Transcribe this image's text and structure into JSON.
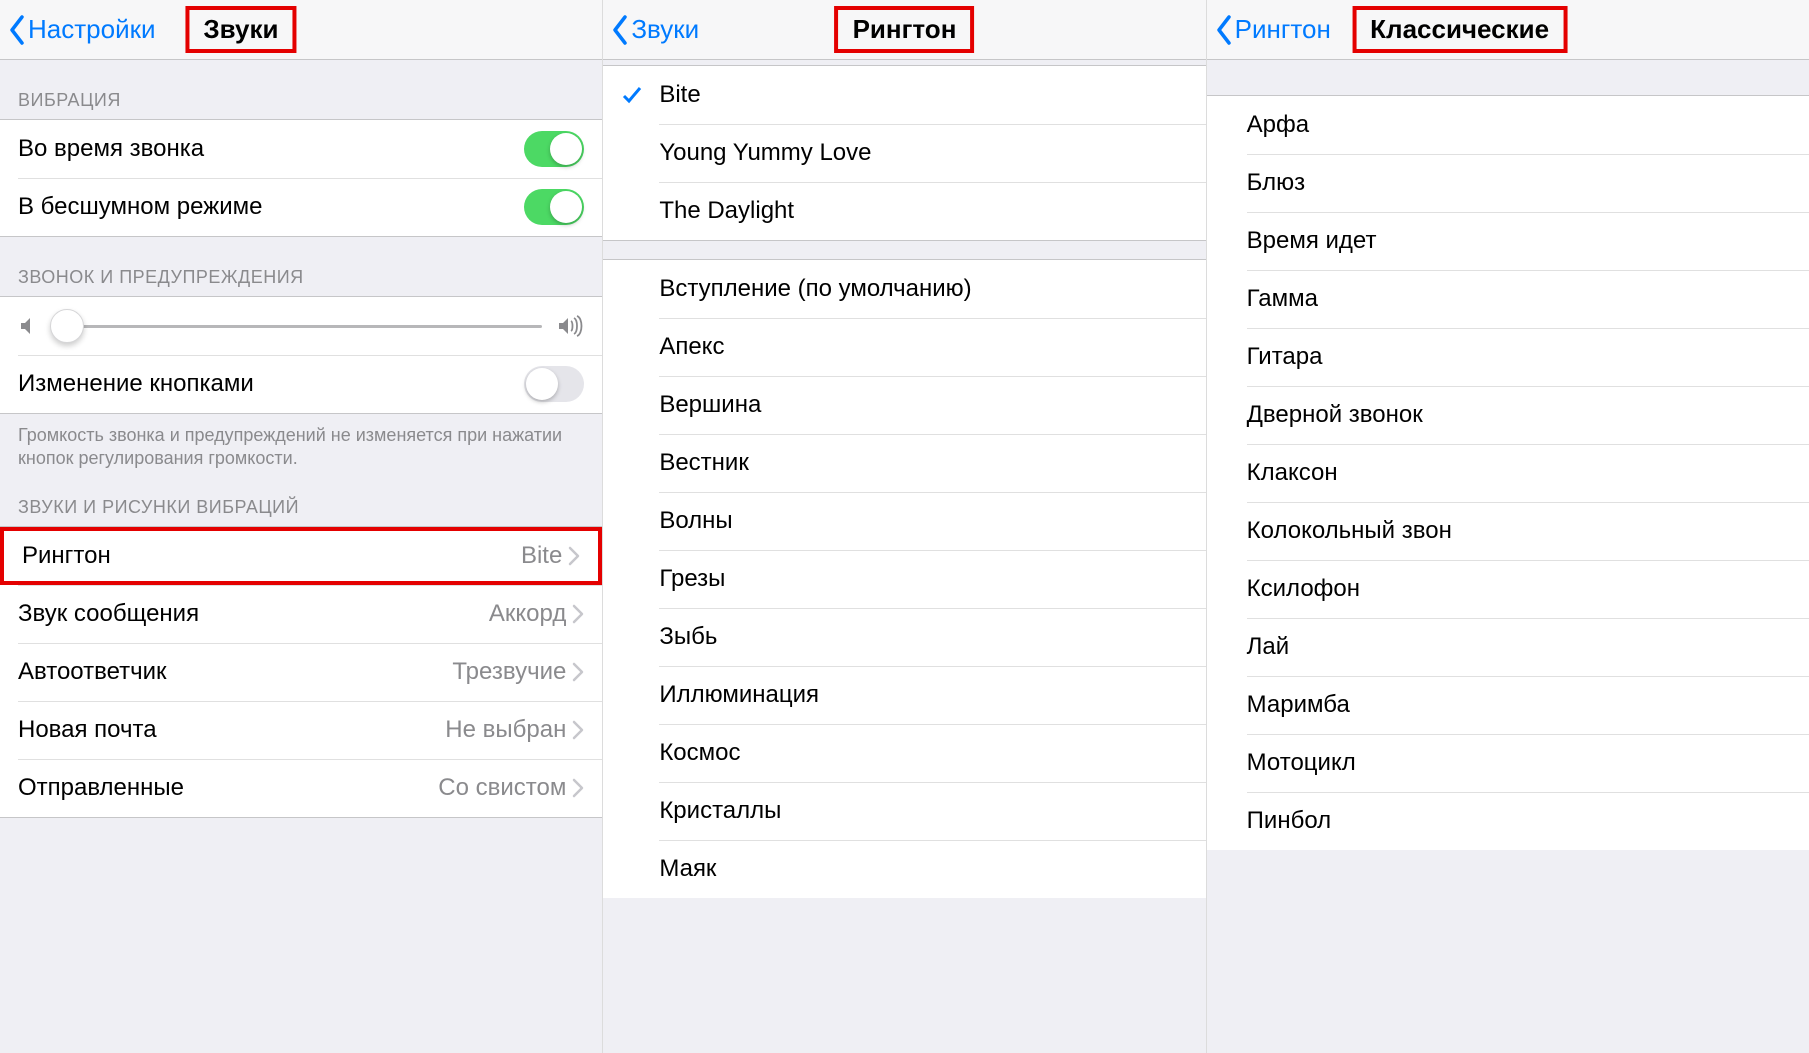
{
  "panel1": {
    "back_label": "Настройки",
    "title": "Звуки",
    "section_vibration": "ВИБРАЦИЯ",
    "vib_ring": "Во время звонка",
    "vib_silent": "В бесшумном режиме",
    "section_ring": "ЗВОНОК И ПРЕДУПРЕЖДЕНИЯ",
    "change_buttons": "Изменение кнопками",
    "footer": "Громкость звонка и предупреждений не изменяется при нажатии кнопок регулирования громкости.",
    "section_sounds": "ЗВУКИ И РИСУНКИ ВИБРАЦИЙ",
    "rows": [
      {
        "label": "Рингтон",
        "value": "Bite"
      },
      {
        "label": "Звук сообщения",
        "value": "Аккорд"
      },
      {
        "label": "Автоответчик",
        "value": "Трезвучие"
      },
      {
        "label": "Новая почта",
        "value": "Не выбран"
      },
      {
        "label": "Отправленные",
        "value": "Со свистом"
      }
    ]
  },
  "panel2": {
    "back_label": "Звуки",
    "title": "Рингтон",
    "group_a": [
      {
        "label": "Bite",
        "checked": true
      },
      {
        "label": "Young Yummy Love"
      },
      {
        "label": "The Daylight"
      }
    ],
    "group_b": [
      "Вступление (по умолчанию)",
      "Апекс",
      "Вершина",
      "Вестник",
      "Волны",
      "Грезы",
      "Зыбь",
      "Иллюминация",
      "Космос",
      "Кристаллы",
      "Маяк"
    ]
  },
  "panel3": {
    "back_label": "Рингтон",
    "title": "Классические",
    "items": [
      "Арфа",
      "Блюз",
      "Время идет",
      "Гамма",
      "Гитара",
      "Дверной звонок",
      "Клаксон",
      "Колокольный звон",
      "Ксилофон",
      "Лай",
      "Маримба",
      "Мотоцикл",
      "Пинбол"
    ]
  }
}
